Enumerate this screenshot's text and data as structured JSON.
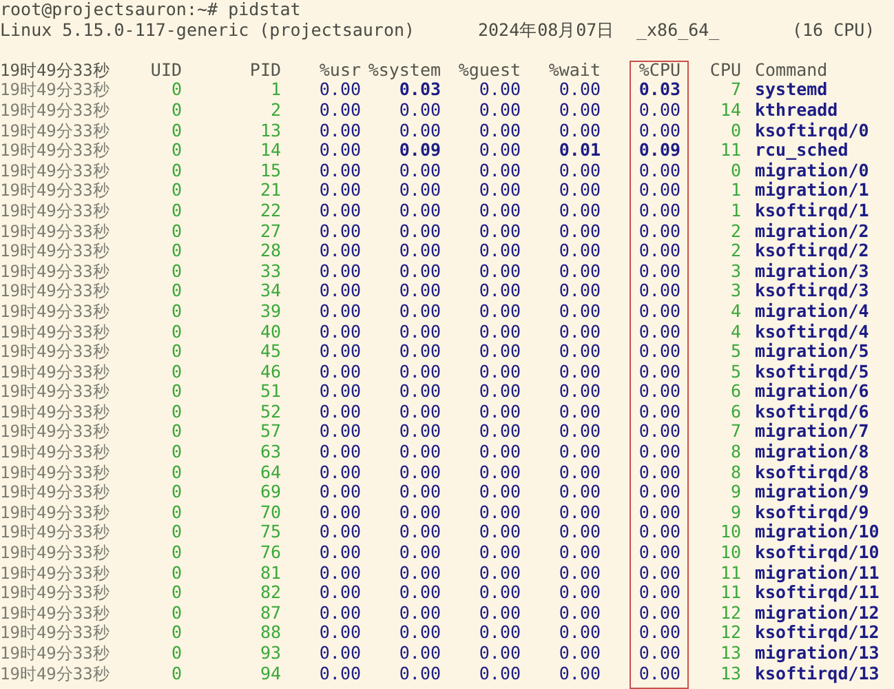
{
  "prompt": "root@projectsauron:~# pidstat",
  "sysinfo": {
    "kernel": "Linux 5.15.0-117-generic (projectsauron)",
    "date": "2024年08月07日",
    "arch": "_x86_64_",
    "cpus": "(16 CPU)"
  },
  "columns": [
    {
      "label": "19时49分33秒",
      "kind": "time",
      "highlighted": false
    },
    {
      "label": "UID",
      "kind": "id",
      "highlighted": false
    },
    {
      "label": "PID",
      "kind": "id",
      "highlighted": false
    },
    {
      "label": "%usr",
      "kind": "num",
      "highlighted": false
    },
    {
      "label": "%system",
      "kind": "num",
      "highlighted": false
    },
    {
      "label": "%guest",
      "kind": "num",
      "highlighted": false
    },
    {
      "label": "%wait",
      "kind": "num",
      "highlighted": false
    },
    {
      "label": "%CPU",
      "kind": "num",
      "highlighted": true
    },
    {
      "label": "CPU",
      "kind": "id",
      "highlighted": false
    },
    {
      "label": "Command",
      "kind": "cmd",
      "highlighted": false
    }
  ],
  "rows": [
    {
      "cells": [
        "19时49分33秒",
        "0",
        "1",
        "0.00",
        "0.03",
        "0.00",
        "0.00",
        "0.03",
        "7",
        "systemd"
      ],
      "bold": [
        false,
        false,
        false,
        false,
        true,
        false,
        false,
        true,
        false,
        false
      ]
    },
    {
      "cells": [
        "19时49分33秒",
        "0",
        "2",
        "0.00",
        "0.00",
        "0.00",
        "0.00",
        "0.00",
        "14",
        "kthreadd"
      ],
      "bold": [
        false,
        false,
        false,
        false,
        false,
        false,
        false,
        false,
        false,
        false
      ]
    },
    {
      "cells": [
        "19时49分33秒",
        "0",
        "13",
        "0.00",
        "0.00",
        "0.00",
        "0.00",
        "0.00",
        "0",
        "ksoftirqd/0"
      ],
      "bold": [
        false,
        false,
        false,
        false,
        false,
        false,
        false,
        false,
        false,
        false
      ]
    },
    {
      "cells": [
        "19时49分33秒",
        "0",
        "14",
        "0.00",
        "0.09",
        "0.00",
        "0.01",
        "0.09",
        "11",
        "rcu_sched"
      ],
      "bold": [
        false,
        false,
        false,
        false,
        true,
        false,
        true,
        true,
        false,
        false
      ]
    },
    {
      "cells": [
        "19时49分33秒",
        "0",
        "15",
        "0.00",
        "0.00",
        "0.00",
        "0.00",
        "0.00",
        "0",
        "migration/0"
      ],
      "bold": [
        false,
        false,
        false,
        false,
        false,
        false,
        false,
        false,
        false,
        false
      ]
    },
    {
      "cells": [
        "19时49分33秒",
        "0",
        "21",
        "0.00",
        "0.00",
        "0.00",
        "0.00",
        "0.00",
        "1",
        "migration/1"
      ],
      "bold": [
        false,
        false,
        false,
        false,
        false,
        false,
        false,
        false,
        false,
        false
      ]
    },
    {
      "cells": [
        "19时49分33秒",
        "0",
        "22",
        "0.00",
        "0.00",
        "0.00",
        "0.00",
        "0.00",
        "1",
        "ksoftirqd/1"
      ],
      "bold": [
        false,
        false,
        false,
        false,
        false,
        false,
        false,
        false,
        false,
        false
      ]
    },
    {
      "cells": [
        "19时49分33秒",
        "0",
        "27",
        "0.00",
        "0.00",
        "0.00",
        "0.00",
        "0.00",
        "2",
        "migration/2"
      ],
      "bold": [
        false,
        false,
        false,
        false,
        false,
        false,
        false,
        false,
        false,
        false
      ]
    },
    {
      "cells": [
        "19时49分33秒",
        "0",
        "28",
        "0.00",
        "0.00",
        "0.00",
        "0.00",
        "0.00",
        "2",
        "ksoftirqd/2"
      ],
      "bold": [
        false,
        false,
        false,
        false,
        false,
        false,
        false,
        false,
        false,
        false
      ]
    },
    {
      "cells": [
        "19时49分33秒",
        "0",
        "33",
        "0.00",
        "0.00",
        "0.00",
        "0.00",
        "0.00",
        "3",
        "migration/3"
      ],
      "bold": [
        false,
        false,
        false,
        false,
        false,
        false,
        false,
        false,
        false,
        false
      ]
    },
    {
      "cells": [
        "19时49分33秒",
        "0",
        "34",
        "0.00",
        "0.00",
        "0.00",
        "0.00",
        "0.00",
        "3",
        "ksoftirqd/3"
      ],
      "bold": [
        false,
        false,
        false,
        false,
        false,
        false,
        false,
        false,
        false,
        false
      ]
    },
    {
      "cells": [
        "19时49分33秒",
        "0",
        "39",
        "0.00",
        "0.00",
        "0.00",
        "0.00",
        "0.00",
        "4",
        "migration/4"
      ],
      "bold": [
        false,
        false,
        false,
        false,
        false,
        false,
        false,
        false,
        false,
        false
      ]
    },
    {
      "cells": [
        "19时49分33秒",
        "0",
        "40",
        "0.00",
        "0.00",
        "0.00",
        "0.00",
        "0.00",
        "4",
        "ksoftirqd/4"
      ],
      "bold": [
        false,
        false,
        false,
        false,
        false,
        false,
        false,
        false,
        false,
        false
      ]
    },
    {
      "cells": [
        "19时49分33秒",
        "0",
        "45",
        "0.00",
        "0.00",
        "0.00",
        "0.00",
        "0.00",
        "5",
        "migration/5"
      ],
      "bold": [
        false,
        false,
        false,
        false,
        false,
        false,
        false,
        false,
        false,
        false
      ]
    },
    {
      "cells": [
        "19时49分33秒",
        "0",
        "46",
        "0.00",
        "0.00",
        "0.00",
        "0.00",
        "0.00",
        "5",
        "ksoftirqd/5"
      ],
      "bold": [
        false,
        false,
        false,
        false,
        false,
        false,
        false,
        false,
        false,
        false
      ]
    },
    {
      "cells": [
        "19时49分33秒",
        "0",
        "51",
        "0.00",
        "0.00",
        "0.00",
        "0.00",
        "0.00",
        "6",
        "migration/6"
      ],
      "bold": [
        false,
        false,
        false,
        false,
        false,
        false,
        false,
        false,
        false,
        false
      ]
    },
    {
      "cells": [
        "19时49分33秒",
        "0",
        "52",
        "0.00",
        "0.00",
        "0.00",
        "0.00",
        "0.00",
        "6",
        "ksoftirqd/6"
      ],
      "bold": [
        false,
        false,
        false,
        false,
        false,
        false,
        false,
        false,
        false,
        false
      ]
    },
    {
      "cells": [
        "19时49分33秒",
        "0",
        "57",
        "0.00",
        "0.00",
        "0.00",
        "0.00",
        "0.00",
        "7",
        "migration/7"
      ],
      "bold": [
        false,
        false,
        false,
        false,
        false,
        false,
        false,
        false,
        false,
        false
      ]
    },
    {
      "cells": [
        "19时49分33秒",
        "0",
        "63",
        "0.00",
        "0.00",
        "0.00",
        "0.00",
        "0.00",
        "8",
        "migration/8"
      ],
      "bold": [
        false,
        false,
        false,
        false,
        false,
        false,
        false,
        false,
        false,
        false
      ]
    },
    {
      "cells": [
        "19时49分33秒",
        "0",
        "64",
        "0.00",
        "0.00",
        "0.00",
        "0.00",
        "0.00",
        "8",
        "ksoftirqd/8"
      ],
      "bold": [
        false,
        false,
        false,
        false,
        false,
        false,
        false,
        false,
        false,
        false
      ]
    },
    {
      "cells": [
        "19时49分33秒",
        "0",
        "69",
        "0.00",
        "0.00",
        "0.00",
        "0.00",
        "0.00",
        "9",
        "migration/9"
      ],
      "bold": [
        false,
        false,
        false,
        false,
        false,
        false,
        false,
        false,
        false,
        false
      ]
    },
    {
      "cells": [
        "19时49分33秒",
        "0",
        "70",
        "0.00",
        "0.00",
        "0.00",
        "0.00",
        "0.00",
        "9",
        "ksoftirqd/9"
      ],
      "bold": [
        false,
        false,
        false,
        false,
        false,
        false,
        false,
        false,
        false,
        false
      ]
    },
    {
      "cells": [
        "19时49分33秒",
        "0",
        "75",
        "0.00",
        "0.00",
        "0.00",
        "0.00",
        "0.00",
        "10",
        "migration/10"
      ],
      "bold": [
        false,
        false,
        false,
        false,
        false,
        false,
        false,
        false,
        false,
        false
      ]
    },
    {
      "cells": [
        "19时49分33秒",
        "0",
        "76",
        "0.00",
        "0.00",
        "0.00",
        "0.00",
        "0.00",
        "10",
        "ksoftirqd/10"
      ],
      "bold": [
        false,
        false,
        false,
        false,
        false,
        false,
        false,
        false,
        false,
        false
      ]
    },
    {
      "cells": [
        "19时49分33秒",
        "0",
        "81",
        "0.00",
        "0.00",
        "0.00",
        "0.00",
        "0.00",
        "11",
        "migration/11"
      ],
      "bold": [
        false,
        false,
        false,
        false,
        false,
        false,
        false,
        false,
        false,
        false
      ]
    },
    {
      "cells": [
        "19时49分33秒",
        "0",
        "82",
        "0.00",
        "0.00",
        "0.00",
        "0.00",
        "0.00",
        "11",
        "ksoftirqd/11"
      ],
      "bold": [
        false,
        false,
        false,
        false,
        false,
        false,
        false,
        false,
        false,
        false
      ]
    },
    {
      "cells": [
        "19时49分33秒",
        "0",
        "87",
        "0.00",
        "0.00",
        "0.00",
        "0.00",
        "0.00",
        "12",
        "migration/12"
      ],
      "bold": [
        false,
        false,
        false,
        false,
        false,
        false,
        false,
        false,
        false,
        false
      ]
    },
    {
      "cells": [
        "19时49分33秒",
        "0",
        "88",
        "0.00",
        "0.00",
        "0.00",
        "0.00",
        "0.00",
        "12",
        "ksoftirqd/12"
      ],
      "bold": [
        false,
        false,
        false,
        false,
        false,
        false,
        false,
        false,
        false,
        false
      ]
    },
    {
      "cells": [
        "19时49分33秒",
        "0",
        "93",
        "0.00",
        "0.00",
        "0.00",
        "0.00",
        "0.00",
        "13",
        "migration/13"
      ],
      "bold": [
        false,
        false,
        false,
        false,
        false,
        false,
        false,
        false,
        false,
        false
      ]
    },
    {
      "cells": [
        "19时49分33秒",
        "0",
        "94",
        "0.00",
        "0.00",
        "0.00",
        "0.00",
        "0.00",
        "13",
        "ksoftirqd/13"
      ],
      "bold": [
        false,
        false,
        false,
        false,
        false,
        false,
        false,
        false,
        false,
        false
      ]
    }
  ]
}
